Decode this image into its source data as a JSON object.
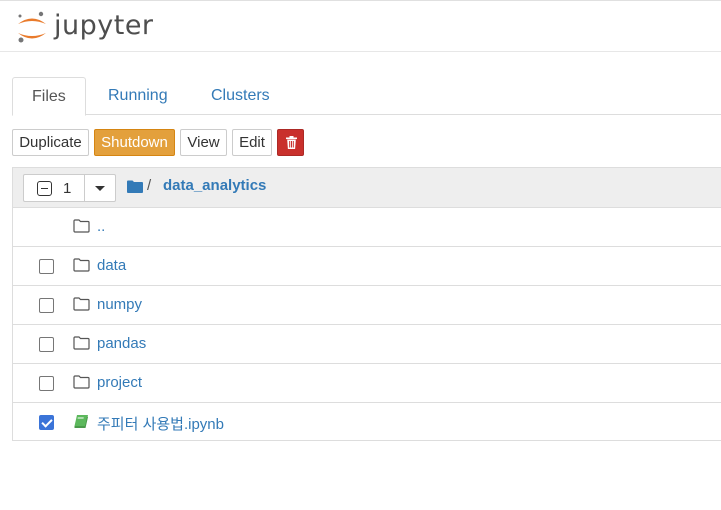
{
  "header": {
    "logo_text": "jupyter",
    "colors": {
      "logo_orange": "#e97b2c",
      "logo_gray": "#767677"
    }
  },
  "tabs": [
    {
      "label": "Files",
      "active": true
    },
    {
      "label": "Running",
      "active": false
    },
    {
      "label": "Clusters",
      "active": false
    }
  ],
  "toolbar": {
    "duplicate": "Duplicate",
    "shutdown": "Shutdown",
    "view": "View",
    "edit": "Edit",
    "delete_icon": "trash-icon"
  },
  "list": {
    "selected_count": "1",
    "breadcrumb_root": "/",
    "breadcrumb_current": "data_analytics",
    "items": [
      {
        "name": "..",
        "type": "folder",
        "checked": false,
        "has_checkbox": false
      },
      {
        "name": "data",
        "type": "folder",
        "checked": false,
        "has_checkbox": true
      },
      {
        "name": "numpy",
        "type": "folder",
        "checked": false,
        "has_checkbox": true
      },
      {
        "name": "pandas",
        "type": "folder",
        "checked": false,
        "has_checkbox": true
      },
      {
        "name": "project",
        "type": "folder",
        "checked": false,
        "has_checkbox": true
      },
      {
        "name": "주피터 사용법.ipynb",
        "type": "notebook",
        "checked": true,
        "has_checkbox": true
      }
    ]
  }
}
